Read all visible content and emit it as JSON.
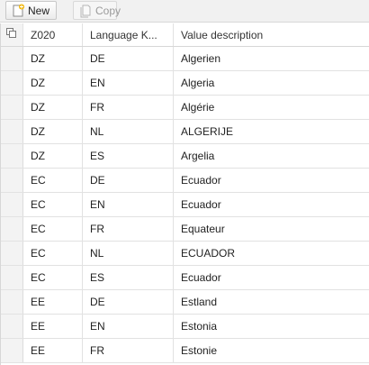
{
  "toolbar": {
    "new_label": "New",
    "copy_label": "Copy"
  },
  "table": {
    "headers": [
      "Z020",
      "Language K...",
      "Value description"
    ],
    "rows": [
      [
        "DZ",
        "DE",
        "Algerien"
      ],
      [
        "DZ",
        "EN",
        "Algeria"
      ],
      [
        "DZ",
        "FR",
        "Algérie"
      ],
      [
        "DZ",
        "NL",
        "ALGERIJE"
      ],
      [
        "DZ",
        "ES",
        "Argelia"
      ],
      [
        "EC",
        "DE",
        "Ecuador"
      ],
      [
        "EC",
        "EN",
        "Ecuador"
      ],
      [
        "EC",
        "FR",
        "Equateur"
      ],
      [
        "EC",
        "NL",
        "ECUADOR"
      ],
      [
        "EC",
        "ES",
        "Ecuador"
      ],
      [
        "EE",
        "DE",
        "Estland"
      ],
      [
        "EE",
        "EN",
        "Estonia"
      ],
      [
        "EE",
        "FR",
        "Estonie"
      ]
    ]
  },
  "colors": {
    "toolbar_bg": "#f1f1f1",
    "grid_line": "#e2e2e2",
    "selector_col_bg": "#f3f3f3",
    "new_icon_accent": "#f0b400"
  }
}
